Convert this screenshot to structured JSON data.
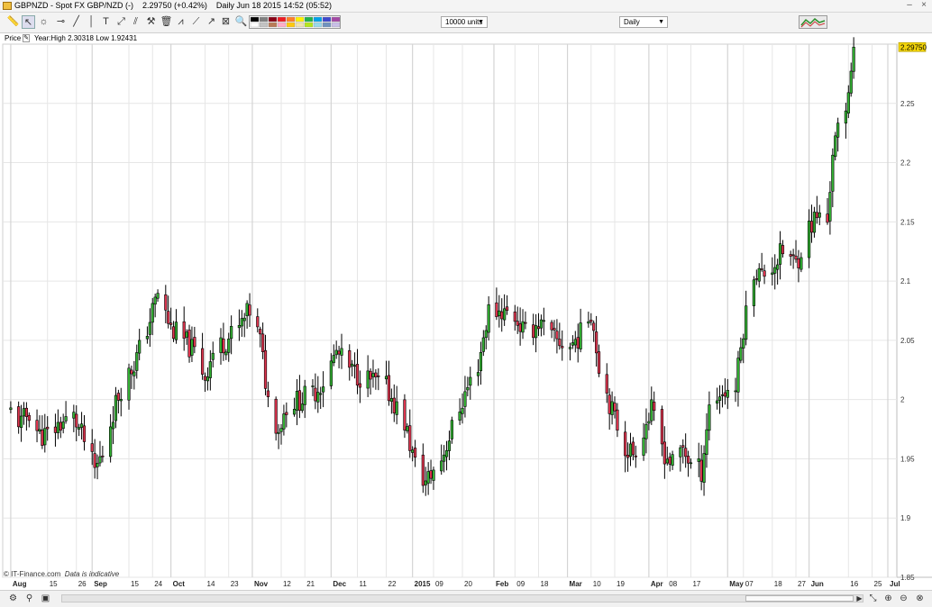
{
  "window": {
    "title": "GBPNZD - Spot FX GBP/NZD (-)",
    "last_price": "2.29750 (+0.42%)",
    "period_info": "Daily  Jun 18 2015 14:52 (05:52)"
  },
  "toolbar": {
    "units_select": "10000 units",
    "interval_select": "Daily"
  },
  "price_panel": {
    "label": "Price",
    "year_range": "Year:High 2.30318 Low 1.92431",
    "current_price_label": "2.29750"
  },
  "footnote": {
    "source": "© IT-Finance.com",
    "disclaimer": "Data is indicative"
  },
  "colors": {
    "up_candle": "#33b233",
    "down_candle": "#e0354f",
    "grid": "#e6e6e6",
    "price_marker": "#f2d40a"
  },
  "chart_data": {
    "type": "candlestick",
    "title": "GBPNZD - Spot FX GBP/NZD (-)",
    "instrument": "GBP/NZD",
    "interval": "Daily",
    "ylim": [
      1.85,
      2.3
    ],
    "y_ticks": [
      "1.85",
      "1.9",
      "1.95",
      "2",
      "2.05",
      "2.1",
      "2.15",
      "2.2",
      "2.25"
    ],
    "x_tick_labels": [
      "Aug",
      "15",
      "26",
      "Sep",
      "15",
      "24",
      "Oct",
      "14",
      "23",
      "Nov",
      "12",
      "21",
      "Dec",
      "11",
      "22",
      "2015",
      "09",
      "20",
      "Feb",
      "09",
      "18",
      "Mar",
      "10",
      "19",
      "Apr",
      "08",
      "17",
      "May",
      "07",
      "18",
      "27",
      "Jun",
      "16",
      "25",
      "Jul"
    ],
    "x_tick_bold": [
      true,
      false,
      false,
      true,
      false,
      false,
      true,
      false,
      false,
      true,
      false,
      false,
      true,
      false,
      false,
      true,
      false,
      false,
      true,
      false,
      false,
      true,
      false,
      false,
      true,
      false,
      false,
      true,
      false,
      false,
      false,
      true,
      false,
      false,
      true
    ],
    "grid": true,
    "last_value": 2.2975,
    "year_high": 2.30318,
    "year_low": 1.92431,
    "anchor_closes": [
      [
        "2014-08-01",
        1.99
      ],
      [
        "2014-08-05",
        1.98
      ],
      [
        "2014-08-08",
        1.99
      ],
      [
        "2014-08-12",
        1.97
      ],
      [
        "2014-08-15",
        1.97
      ],
      [
        "2014-08-20",
        1.98
      ],
      [
        "2014-08-25",
        1.985
      ],
      [
        "2014-08-29",
        1.965
      ],
      [
        "2014-09-02",
        1.94
      ],
      [
        "2014-09-05",
        1.955
      ],
      [
        "2014-09-09",
        1.99
      ],
      [
        "2014-09-12",
        2.01
      ],
      [
        "2014-09-17",
        2.03
      ],
      [
        "2014-09-22",
        2.06
      ],
      [
        "2014-09-26",
        2.09
      ],
      [
        "2014-10-01",
        2.06
      ],
      [
        "2014-10-06",
        2.05
      ],
      [
        "2014-10-10",
        2.04
      ],
      [
        "2014-10-14",
        2.02
      ],
      [
        "2014-10-17",
        2.04
      ],
      [
        "2014-10-22",
        2.05
      ],
      [
        "2014-10-27",
        2.06
      ],
      [
        "2014-10-31",
        2.075
      ],
      [
        "2014-11-04",
        2.05
      ],
      [
        "2014-11-07",
        2.0
      ],
      [
        "2014-11-11",
        1.975
      ],
      [
        "2014-11-14",
        1.995
      ],
      [
        "2014-11-19",
        2.0
      ],
      [
        "2014-11-24",
        2.005
      ],
      [
        "2014-11-28",
        2.015
      ],
      [
        "2014-12-03",
        2.04
      ],
      [
        "2014-12-08",
        2.025
      ],
      [
        "2014-12-12",
        2.02
      ],
      [
        "2014-12-17",
        2.015
      ],
      [
        "2014-12-22",
        2.01
      ],
      [
        "2014-12-29",
        1.98
      ],
      [
        "2015-01-02",
        1.945
      ],
      [
        "2015-01-06",
        1.93
      ],
      [
        "2015-01-12",
        1.95
      ],
      [
        "2015-01-16",
        1.975
      ],
      [
        "2015-01-21",
        2.005
      ],
      [
        "2015-01-26",
        2.03
      ],
      [
        "2015-01-30",
        2.075
      ],
      [
        "2015-02-04",
        2.075
      ],
      [
        "2015-02-09",
        2.07
      ],
      [
        "2015-02-13",
        2.055
      ],
      [
        "2015-02-18",
        2.065
      ],
      [
        "2015-02-24",
        2.05
      ],
      [
        "2015-03-02",
        2.045
      ],
      [
        "2015-03-06",
        2.055
      ],
      [
        "2015-03-10",
        2.075
      ],
      [
        "2015-03-13",
        2.03
      ],
      [
        "2015-03-18",
        1.99
      ],
      [
        "2015-03-23",
        1.96
      ],
      [
        "2015-03-26",
        1.955
      ],
      [
        "2015-03-30",
        1.975
      ],
      [
        "2015-04-02",
        1.99
      ],
      [
        "2015-04-07",
        1.955
      ],
      [
        "2015-04-10",
        1.945
      ],
      [
        "2015-04-14",
        1.96
      ],
      [
        "2015-04-17",
        1.945
      ],
      [
        "2015-04-21",
        1.94
      ],
      [
        "2015-04-24",
        1.995
      ],
      [
        "2015-04-28",
        2.005
      ],
      [
        "2015-05-04",
        2.01
      ],
      [
        "2015-05-07",
        2.06
      ],
      [
        "2015-05-11",
        2.11
      ],
      [
        "2015-05-14",
        2.105
      ],
      [
        "2015-05-19",
        2.115
      ],
      [
        "2015-05-22",
        2.125
      ],
      [
        "2015-05-27",
        2.115
      ],
      [
        "2015-06-01",
        2.145
      ],
      [
        "2015-06-04",
        2.155
      ],
      [
        "2015-06-08",
        2.15
      ],
      [
        "2015-06-10",
        2.21
      ],
      [
        "2015-06-12",
        2.225
      ],
      [
        "2015-06-15",
        2.24
      ],
      [
        "2015-06-17",
        2.285
      ],
      [
        "2015-06-18",
        2.2975
      ]
    ]
  }
}
